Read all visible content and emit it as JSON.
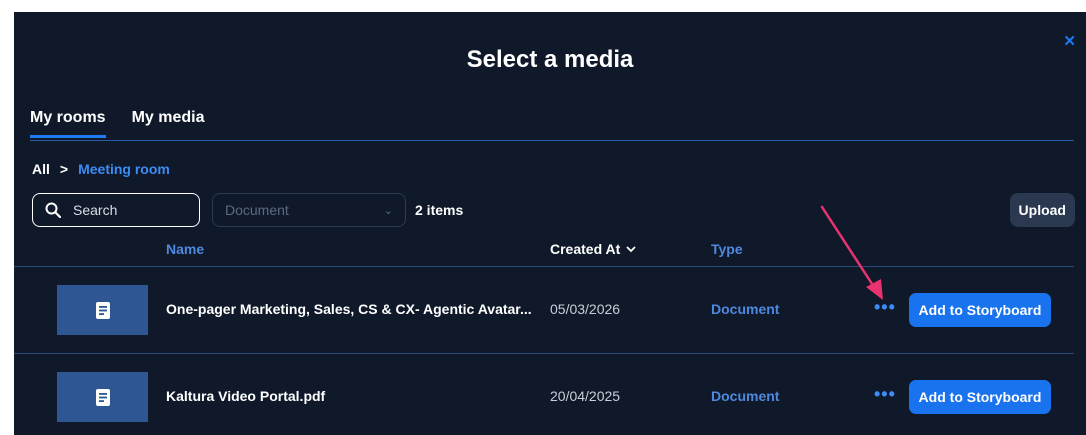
{
  "dialog": {
    "title": "Select a media",
    "close_icon": "close-icon",
    "close_glyph": "✕"
  },
  "tabs": [
    {
      "label": "My rooms",
      "active": true
    },
    {
      "label": "My media",
      "active": false
    }
  ],
  "breadcrumb": {
    "root": "All",
    "separator": ">",
    "current": "Meeting room"
  },
  "toolbar": {
    "search_placeholder": "Search",
    "filter_value": "Document",
    "item_count": "2 items",
    "upload_label": "Upload"
  },
  "table": {
    "headers": {
      "name": "Name",
      "created_at": "Created At",
      "type": "Type"
    },
    "rows": [
      {
        "name": "One-pager Marketing, Sales, CS & CX- Agentic Avatar...",
        "created_at": "05/03/2026",
        "type": "Document",
        "more": "•••",
        "action": "Add to Storyboard"
      },
      {
        "name": "Kaltura Video Portal.pdf",
        "created_at": "20/04/2025",
        "type": "Document",
        "more": "•••",
        "action": "Add to Storyboard"
      }
    ]
  },
  "colors": {
    "background": "#0f1929",
    "accent": "#1a73ee",
    "link": "#3d8bf5",
    "annotation_arrow": "#e8336e"
  }
}
